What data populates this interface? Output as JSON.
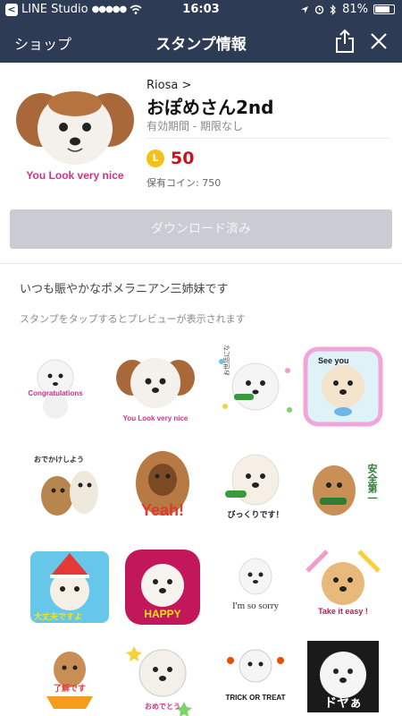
{
  "status_bar": {
    "carrier": "LINE Studio",
    "signal": "●●●●●",
    "time": "16:03",
    "battery": "81%",
    "battery_level": 0.81
  },
  "nav": {
    "back_label": "ショップ",
    "title": "スタンプ情報",
    "share_icon": "share-icon",
    "close_icon": "close-icon"
  },
  "pack": {
    "author": "Riosa >",
    "title": "おぽめさん2nd",
    "validity": "有効期間 - 期限なし",
    "coin_letter": "L",
    "price": "50",
    "owned_coins": "保有コイン: 750",
    "main_caption": "You Look very nice"
  },
  "download_button": "ダウンロード済み",
  "description": "いつも賑やかなポメラニアン三姉妹です",
  "hint": "スタンプをタップするとプレビューが表示されます",
  "stickers": [
    {
      "caption": "Congratulations"
    },
    {
      "caption": "You Look very nice"
    },
    {
      "caption": "お世話になります"
    },
    {
      "caption": "See you"
    },
    {
      "caption": "おでかけしよう"
    },
    {
      "caption": "Yeah!"
    },
    {
      "caption": "びっくりです！"
    },
    {
      "caption": "安全第一"
    },
    {
      "caption": "大丈夫ですよ"
    },
    {
      "caption": "HAPPY"
    },
    {
      "caption": "I'm so sorry"
    },
    {
      "caption": "Take it easy !"
    },
    {
      "caption": "了解です"
    },
    {
      "caption": "おめでとう"
    },
    {
      "caption": "TRICK OR TREAT"
    },
    {
      "caption": "ドヤぁ"
    }
  ],
  "colors": {
    "nav_bg": "#2e3b55",
    "price": "#c4161c",
    "coin": "#f3c21a",
    "button_disabled": "#c9ccd3"
  }
}
